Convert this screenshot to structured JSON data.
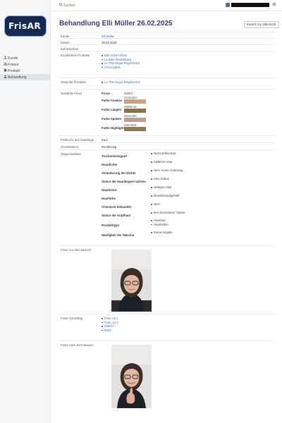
{
  "app": {
    "logo_text": "FrisAR"
  },
  "topbar": {
    "search_placeholder": "Suchen"
  },
  "sidebar": {
    "items": [
      {
        "label": "Kunde",
        "icon": "user-icon"
      },
      {
        "label": "Friseur",
        "icon": "scissors-icon"
      },
      {
        "label": "Produkt",
        "icon": "box-icon"
      },
      {
        "label": "Behandlung",
        "icon": "treatment-icon",
        "active": true
      }
    ]
  },
  "page": {
    "title": "Behandlung Elli Müller 26.02.2025",
    "back_button": "Zurück zur Übersicht"
  },
  "details": {
    "kunde": {
      "label": "Kunde",
      "value": "Elli Müller"
    },
    "datum": {
      "label": "Datum",
      "value": "26.02.2025"
    },
    "zufriedenheit": {
      "label": "Zufriedenheit",
      "value": ""
    },
    "empfohlene": {
      "label": "Empfohlene Produkte",
      "items": [
        "Bain Elixir Ultime",
        "Le Bain Revitalisant",
        "Le Thermique Régénérant",
        "L'Incroyable"
      ]
    },
    "gekaufte": {
      "label": "Gekaufte Produkte",
      "items": [
        "Le Thermique Régénérant"
      ]
    },
    "frisur": {
      "label": "Gewählte Frisur",
      "frisur_key": "Frisur",
      "frisur_value": "Bild83",
      "colors": [
        {
          "key": "Farbe Ansätze",
          "code": "#C8A284",
          "color": "#C8A284"
        },
        {
          "key": "Farbe Längen",
          "code": "#8B6F48",
          "color": "#8B6F48"
        },
        {
          "key": "Farbe Spitzen",
          "code": "#B6A290",
          "color": "#B6A290"
        },
        {
          "key": "Farbe Highlights",
          "code": "#8E7659",
          "color": "#8E7659"
        }
      ]
    },
    "haarlaenge": {
      "label": "Präferenz der Haarlänge",
      "value": "Kurz"
    },
    "gesichtsform": {
      "label": "Gesichtsform",
      "value": "Rechteckig"
    },
    "diagnose": {
      "label": "Diagnosedaten",
      "rows": [
        {
          "key": "Trockenheitsgrad",
          "values": [
            "Nicht definierbar"
          ]
        },
        {
          "key": "Haardichte",
          "values": [
            "mittleres Haar"
          ]
        },
        {
          "key": "Veränderung der Dichte",
          "values": [
            "Nein, keine Änderung"
          ]
        },
        {
          "key": "Status der Haarlängen/ spitzen",
          "values": [
            "Kein Status"
          ]
        },
        {
          "key": "Haartextur",
          "values": [
            "welliges Haar"
          ]
        },
        {
          "key": "Haarfarbe",
          "values": [
            "blondiert/aufgehellt"
          ]
        },
        {
          "key": "Chemisch behandelt",
          "values": [
            "Nein"
          ]
        },
        {
          "key": "Status der Kopfhaut",
          "values": [
            "kein besonderer Status"
          ]
        },
        {
          "key": "Produkttype",
          "values": [
            "Haarbad",
            "Haarkelten"
          ]
        },
        {
          "key": "Häufigkeit der Wäsche",
          "values": [
            "Keine Angabe"
          ]
        }
      ]
    },
    "vor_besuch": {
      "label": "Frisur vor dem Besuch"
    },
    "vorschlag": {
      "label": "Frisur Vorschlag",
      "items": [
        "Pixie cut 1",
        "Pixie cut 2",
        "Bild#17",
        "Bild3"
      ]
    },
    "nach_besuch": {
      "label": "Frisur nach dem Besuch"
    }
  },
  "colors": {
    "accent": "#3a3d7a",
    "link": "#3b6fc4",
    "logo_bg": "#152a52"
  }
}
